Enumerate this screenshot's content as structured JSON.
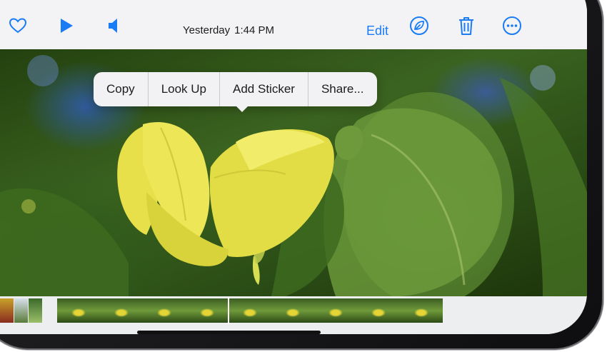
{
  "toolbar": {
    "date": "Yesterday",
    "time": "1:44 PM",
    "edit_label": "Edit"
  },
  "icons": {
    "favorite": "heart-icon",
    "play": "play-icon",
    "volume": "speaker-icon",
    "visual_lookup": "leaf-info-icon",
    "delete": "trash-icon",
    "more": "ellipsis-circle-icon"
  },
  "context_menu": {
    "items": [
      "Copy",
      "Look Up",
      "Add Sticker",
      "Share..."
    ]
  },
  "colors": {
    "accent": "#1a7cf5",
    "toolbar_bg": "#f3f3f5",
    "flower": "#e8e04a"
  }
}
